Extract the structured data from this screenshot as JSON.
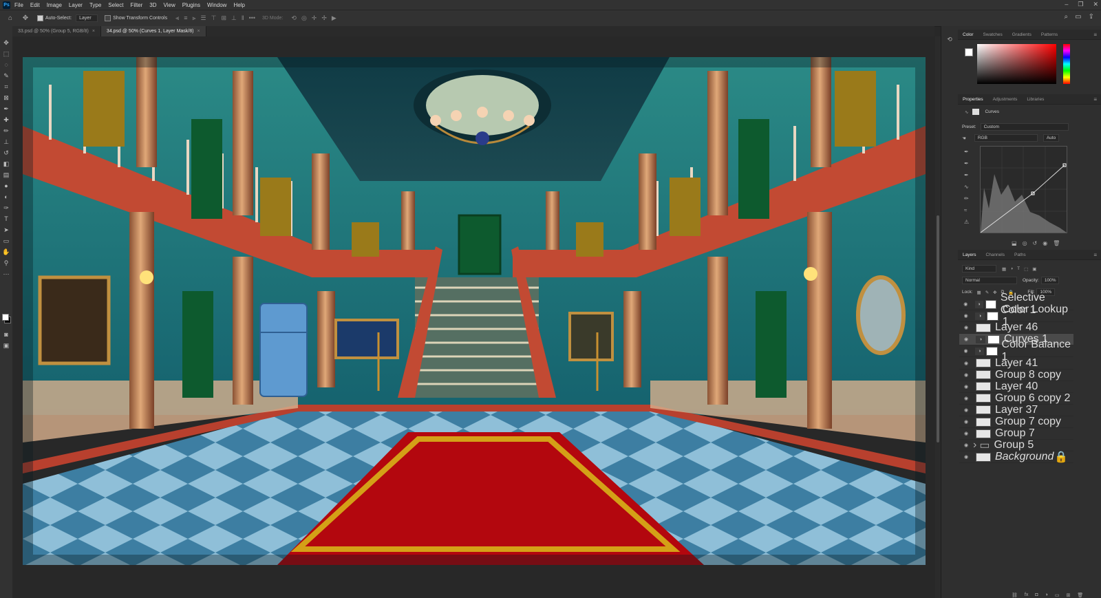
{
  "app": {
    "logo": "Ps"
  },
  "menu": [
    "File",
    "Edit",
    "Image",
    "Layer",
    "Type",
    "Select",
    "Filter",
    "3D",
    "View",
    "Plugins",
    "Window",
    "Help"
  ],
  "window_controls": [
    "–",
    "❐",
    "✕"
  ],
  "options": {
    "auto_select_label": "Auto-Select:",
    "auto_select_value": "Layer",
    "show_transform_label": "Show Transform Controls",
    "mode_3d": "3D Mode:"
  },
  "tabs": [
    {
      "label": "33.psd @ 50% (Group 5, RGB/8)",
      "active": false
    },
    {
      "label": "34.psd @ 50% (Curves 1, Layer Mask/8)",
      "active": true
    }
  ],
  "color_panel": {
    "tabs": [
      "Color",
      "Swatches",
      "Gradients",
      "Patterns"
    ],
    "active": "Color"
  },
  "properties_panel": {
    "tabs": [
      "Properties",
      "Adjustments",
      "Libraries"
    ],
    "active": "Properties",
    "adjustment": "Curves",
    "preset_label": "Preset:",
    "preset_value": "Custom",
    "channel_value": "RGB",
    "auto_button": "Auto"
  },
  "layers_panel": {
    "tabs": [
      "Layers",
      "Channels",
      "Paths"
    ],
    "active": "Layers",
    "filter": "Kind",
    "blend_mode": "Normal",
    "opacity_label": "Opacity:",
    "opacity_value": "100%",
    "lock_label": "Lock:",
    "fill_label": "Fill:",
    "fill_value": "100%",
    "layers": [
      {
        "name": "Selective Color 1",
        "type": "adjustment",
        "selected": false
      },
      {
        "name": "Color Lookup 1",
        "type": "adjustment",
        "selected": false
      },
      {
        "name": "Layer 46",
        "type": "pixel",
        "selected": false
      },
      {
        "name": "Curves 1",
        "type": "adjustment",
        "selected": true
      },
      {
        "name": "Color Balance 1",
        "type": "adjustment",
        "selected": false
      },
      {
        "name": "Layer 41",
        "type": "pixel",
        "selected": false
      },
      {
        "name": "Group 8 copy",
        "type": "pixel",
        "selected": false
      },
      {
        "name": "Layer 40",
        "type": "pixel",
        "selected": false
      },
      {
        "name": "Group 6 copy 2",
        "type": "pixel",
        "selected": false
      },
      {
        "name": "Layer 37",
        "type": "pixel",
        "selected": false
      },
      {
        "name": "Group 7 copy",
        "type": "pixel",
        "selected": false
      },
      {
        "name": "Group 7",
        "type": "pixel",
        "selected": false
      },
      {
        "name": "Group 5",
        "type": "group",
        "selected": false
      },
      {
        "name": "Background",
        "type": "background",
        "selected": false
      }
    ]
  },
  "colors": {
    "wall": "#1f6f78",
    "floor_light": "#6ea8c8",
    "floor_dark": "#3d7ea2",
    "carpet": "#b3070e",
    "carpet_border": "#d4a017",
    "rail": "#c24a33",
    "column": "#c98a5a"
  }
}
